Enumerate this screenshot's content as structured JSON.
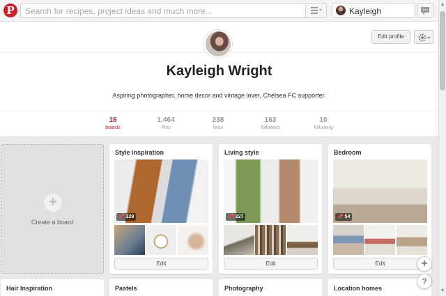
{
  "header": {
    "logo_letter": "P",
    "search_placeholder": "Search for recipes, project ideas and much more...",
    "user_name": "Kayleigh"
  },
  "profile": {
    "edit_label": "Edit profile",
    "name": "Kayleigh Wright",
    "bio": "Aspiring photographer, home decor and vintage lover, Chelsea FC supporter.",
    "stats": [
      {
        "value": "16",
        "label": "boards"
      },
      {
        "value": "1,464",
        "label": "Pins"
      },
      {
        "value": "238",
        "label": "likes"
      },
      {
        "value": "163",
        "label": "followers"
      },
      {
        "value": "10",
        "label": "following"
      }
    ]
  },
  "create_board": {
    "plus": "+",
    "label": "Create a board"
  },
  "boards": [
    {
      "title": "Style inspiration",
      "pins": "329",
      "edit_label": "Edit"
    },
    {
      "title": "Living style",
      "pins": "227",
      "edit_label": "Edit"
    },
    {
      "title": "Bedroom",
      "pins": "54",
      "edit_label": "Edit"
    }
  ],
  "bottom_boards": [
    {
      "title": "Hair Inspiration"
    },
    {
      "title": "Pastels"
    },
    {
      "title": "Photography"
    },
    {
      "title": "Location homes"
    }
  ],
  "floating": {
    "add": "+",
    "help": "?"
  },
  "colors": {
    "brand": "#cb2027",
    "active_stat": "#b0262c"
  }
}
